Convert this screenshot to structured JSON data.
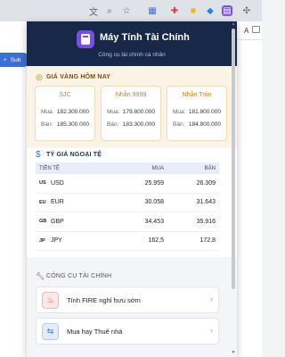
{
  "browser": {
    "icons": [
      "translate-icon",
      "zoom-icon",
      "star-icon",
      "extension-a-icon",
      "extension-b-icon",
      "extension-c-icon",
      "extension-d-icon",
      "calculator-extension-icon",
      "puzzle-icon"
    ],
    "left_button_label": "Sub",
    "right_tab_letter": "A"
  },
  "header": {
    "title": "Máy Tính Tài Chính",
    "subtitle": "Công cụ tài chính cá nhân"
  },
  "gold": {
    "title": "GIÁ VÀNG HÔM NAY",
    "buy_label": "Mua:",
    "sell_label": "Bán:",
    "cards": [
      {
        "name": "SJC",
        "buy": "182.300.000",
        "sell": "185.300.000"
      },
      {
        "name": "Nhẫn 9999",
        "buy": "179.800.000",
        "sell": "183.300.000"
      },
      {
        "name": "Nhẫn Tròn",
        "buy": "181.800.000",
        "sell": "184.800.000"
      }
    ]
  },
  "fx": {
    "title": "TỶ GIÁ NGOẠI TỆ",
    "headers": {
      "currency": "TIỀN TỆ",
      "buy": "MUA",
      "sell": "BÁN"
    },
    "rows": [
      {
        "flag": "US",
        "code": "USD",
        "buy": "25.959",
        "sell": "26.309"
      },
      {
        "flag": "EU",
        "code": "EUR",
        "buy": "30.058",
        "sell": "31.643"
      },
      {
        "flag": "GB",
        "code": "GBP",
        "buy": "34.453",
        "sell": "35.916"
      },
      {
        "flag": "JP",
        "code": "JPY",
        "buy": "162,5",
        "sell": "172,8"
      }
    ]
  },
  "tools": {
    "title": "CÔNG CỤ TÀI CHÍNH",
    "items": [
      {
        "label": "Tính FIRE nghỉ hưu sớm",
        "icon": "fire-icon"
      },
      {
        "label": "Mua hay Thuê nhà",
        "icon": "swap-arrows-icon"
      }
    ]
  },
  "colors": {
    "header_bg": "#182848",
    "gold_accent": "#cf7a1e",
    "fx_accent": "#3a6fd8"
  }
}
